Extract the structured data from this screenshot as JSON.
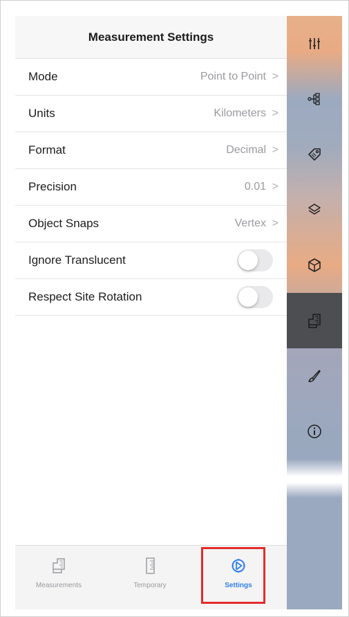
{
  "header": {
    "title": "Measurement Settings"
  },
  "settings": {
    "rows": [
      {
        "label": "Mode",
        "value": "Point to Point",
        "chevron": ">"
      },
      {
        "label": "Units",
        "value": "Kilometers",
        "chevron": ">"
      },
      {
        "label": "Format",
        "value": "Decimal",
        "chevron": ">"
      },
      {
        "label": "Precision",
        "value": "0.01",
        "chevron": ">"
      },
      {
        "label": "Object Snaps",
        "value": "Vertex",
        "chevron": ">"
      }
    ],
    "toggles": [
      {
        "label": "Ignore Translucent",
        "on": false
      },
      {
        "label": "Respect Site Rotation",
        "on": false
      }
    ]
  },
  "tabbar": {
    "tabs": [
      {
        "label": "Measurements",
        "icon": "clipboard-ruler-icon",
        "active": false
      },
      {
        "label": "Temporary",
        "icon": "ruler-icon",
        "active": false
      },
      {
        "label": "Settings",
        "icon": "gear-icon",
        "active": true
      }
    ]
  },
  "toolbar": {
    "tools": [
      {
        "icon": "adjust-sliders-icon",
        "active": false
      },
      {
        "icon": "tree-hierarchy-icon",
        "active": false
      },
      {
        "icon": "tag-icon",
        "active": false
      },
      {
        "icon": "layers-icon",
        "active": false
      },
      {
        "icon": "cube-icon",
        "active": false
      },
      {
        "icon": "measure-icon",
        "active": true
      },
      {
        "icon": "brush-icon",
        "active": false
      },
      {
        "icon": "info-icon",
        "active": false
      }
    ]
  },
  "colors": {
    "accent": "#2f7ff0",
    "highlight_border": "#e32c2c",
    "active_tool_bg": "#4d4e52"
  }
}
